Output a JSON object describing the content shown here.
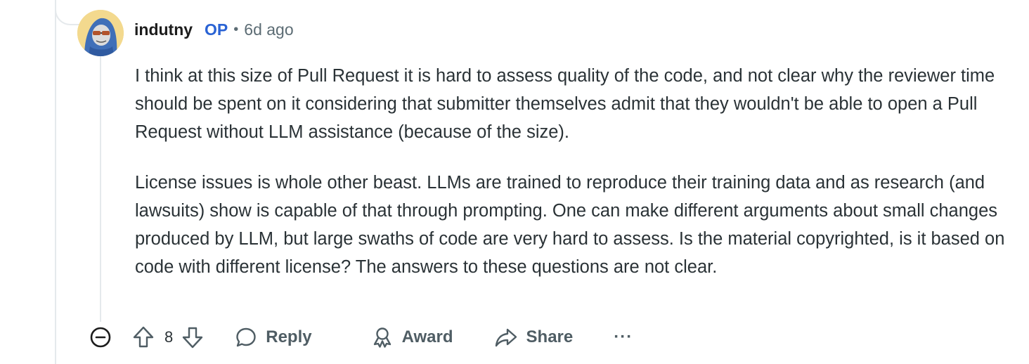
{
  "comment": {
    "author": "indutny",
    "op_badge": "OP",
    "separator": "•",
    "timestamp": "6d ago",
    "avatar_icon": "snoo-avatar-icon",
    "paragraphs": [
      "I think at this size of Pull Request it is hard to assess quality of the code, and not clear why the reviewer time should be spent on it considering that submitter themselves admit that they wouldn't be able to open a Pull Request without LLM assistance (because of the size).",
      "License issues is whole other beast. LLMs are trained to reproduce their training data and as research (and lawsuits) show is capable of that through prompting. One can make different arguments about small changes produced by LLM, but large swaths of code are very hard to assess. Is the material copyrighted, is it based on code with different license? The answers to these questions are not clear."
    ]
  },
  "actions": {
    "collapse_icon": "minus-circle-icon",
    "upvote_icon": "arrow-up-icon",
    "vote_count": "8",
    "downvote_icon": "arrow-down-icon",
    "reply_label": "Reply",
    "reply_icon": "comment-bubble-icon",
    "award_label": "Award",
    "award_icon": "award-ribbon-icon",
    "share_label": "Share",
    "share_icon": "share-arrow-icon",
    "more_label": "···"
  },
  "colors": {
    "op_badge": "#2a63d4",
    "meta_text": "#5c6c74",
    "body_text": "#2a3236",
    "thread_line": "#e5e9ec"
  }
}
